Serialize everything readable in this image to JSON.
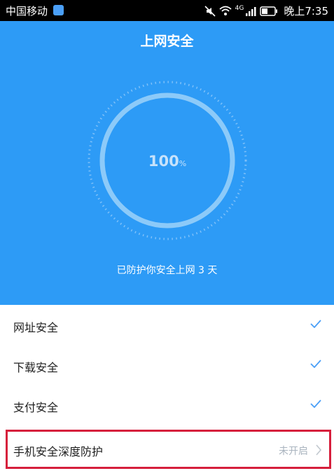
{
  "status_bar": {
    "carrier": "中国移动",
    "network": "4G",
    "time": "晚上7:35"
  },
  "header": {
    "title": "上网安全"
  },
  "gauge": {
    "value": "100",
    "unit": "%",
    "percent": 100,
    "protect_text": "已防护你安全上网 3 天"
  },
  "security_items": [
    {
      "label": "网址安全",
      "status": "checked"
    },
    {
      "label": "下载安全",
      "status": "checked"
    },
    {
      "label": "支付安全",
      "status": "checked"
    }
  ],
  "deep_protection": {
    "label": "手机安全深度防护",
    "status": "未开启"
  },
  "colors": {
    "primary": "#2d9bf6",
    "check": "#4a9ff7",
    "highlight_border": "#d61f3c",
    "status_text": "#aab4bf"
  }
}
